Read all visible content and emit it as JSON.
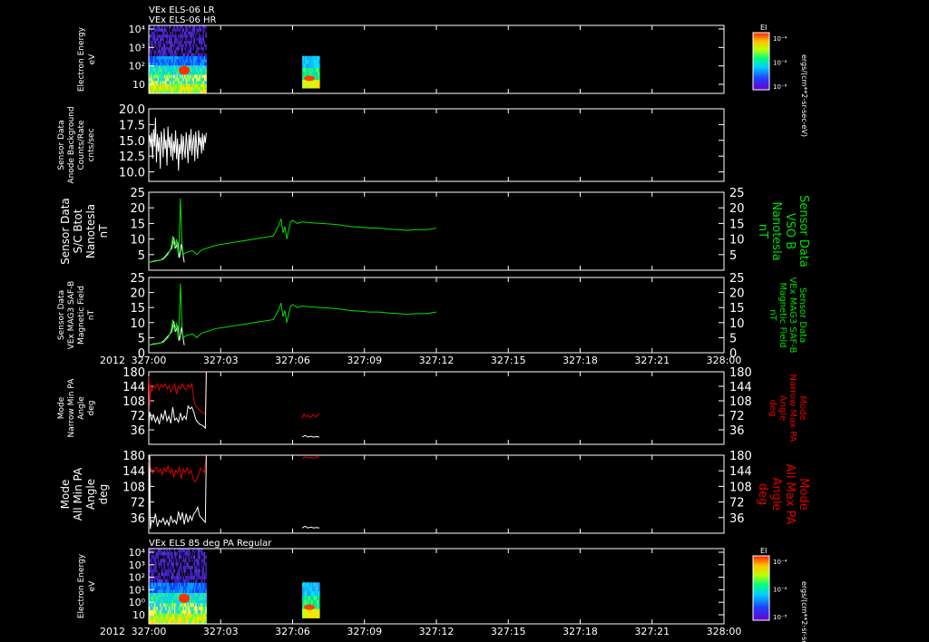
{
  "chart_data": {
    "type": "line",
    "x_axis": {
      "year_label": "2012",
      "range": [
        "327:00",
        "328:00"
      ],
      "ticks": [
        "327:00",
        "327:03",
        "327:06",
        "327:09",
        "327:12",
        "327:15",
        "327:18",
        "327:21",
        "328:00"
      ]
    },
    "panels": [
      {
        "id": "els06",
        "type": "heatmap",
        "titles": [
          "VEx ELS-06 LR",
          "VEx ELS-06 HR"
        ],
        "ylabel": [
          "Electron Energy",
          "eV"
        ],
        "y_ticks": [
          "10",
          "10²",
          "10³",
          "10⁴"
        ],
        "log_y": true,
        "colorbar": {
          "label": "EI",
          "unit": "ergs/(cm**2-sr-sec-eV)",
          "ticks": [
            "10⁻⁴",
            "10⁻⁶",
            "10⁻⁸"
          ]
        },
        "segments": [
          {
            "x": [
              327.0,
              327.06
            ],
            "energy_range_eV": [
              2,
              20000
            ]
          },
          {
            "x": [
              327.16,
              327.18
            ],
            "energy_range_eV": [
              3,
              300
            ]
          }
        ]
      },
      {
        "id": "background",
        "type": "line",
        "ylabel": [
          "Sensor Data",
          "Anode Background",
          "Counts/Rate",
          "cnts/sec"
        ],
        "ylim": [
          8.5,
          20.0
        ],
        "y_ticks": [
          "10.0",
          "12.5",
          "15.0",
          "17.5",
          "20.0"
        ],
        "series": [
          {
            "color": "#ffffff",
            "x": [
              0.0,
              0.1,
              0.2,
              0.3,
              0.4,
              0.5,
              0.6,
              0.7,
              0.8,
              0.9,
              1.0,
              1.1,
              1.2,
              1.3,
              1.4,
              1.5,
              1.6,
              1.7,
              1.8,
              1.9,
              2.0,
              2.1,
              2.2,
              2.3,
              2.4,
              2.5,
              2.6,
              2.7,
              2.8,
              2.9,
              3.0,
              3.1,
              3.2,
              3.3,
              3.4,
              3.5,
              3.6,
              3.7,
              3.8,
              3.9,
              4.0,
              4.1,
              4.2,
              4.3,
              4.4,
              4.5,
              4.6,
              4.7,
              4.8,
              4.9,
              5.0,
              5.1,
              5.2,
              5.3,
              5.4,
              5.5,
              5.6,
              5.7,
              5.8,
              5.9,
              6.0
            ],
            "y": [
              14.5,
              15.8,
              13.9,
              16.2,
              12.1,
              16.8,
              14.0,
              18.6,
              11.5,
              16.0,
              13.2,
              15.5,
              10.5,
              16.4,
              14.8,
              12.3,
              16.9,
              13.6,
              15.1,
              11.0,
              17.2,
              13.8,
              15.6,
              12.4,
              16.1,
              11.8,
              14.9,
              13.0,
              16.6,
              12.0,
              15.3,
              10.2,
              14.4,
              12.8,
              16.0,
              11.9,
              15.7,
              13.5,
              12.2,
              16.3,
              14.1,
              11.4,
              15.9,
              13.3,
              16.8,
              12.6,
              14.7,
              15.9,
              11.7,
              16.4,
              13.9,
              12.1,
              16.6,
              14.2,
              15.5,
              12.9,
              16.1,
              13.4,
              15.8,
              14.6,
              16.2
            ]
          }
        ]
      },
      {
        "id": "bmag",
        "type": "line",
        "ylabel": [
          "Sensor Data",
          "S/C Btot",
          "Nanotesla",
          "nT"
        ],
        "right_label": [
          "Sensor Data",
          "VSO B",
          "Nanotesla",
          "nT"
        ],
        "ylim": [
          0,
          25
        ],
        "y_ticks": [
          "5",
          "10",
          "15",
          "20",
          "25"
        ],
        "series": [
          {
            "color": "#ffffff",
            "x": [
              0.0,
              0.4,
              0.8,
              1.2,
              1.6,
              2.0,
              2.4,
              2.6,
              2.8,
              3.0,
              3.2,
              3.4,
              3.6,
              3.7
            ],
            "y": [
              2.5,
              2.8,
              3.0,
              3.2,
              4.0,
              5.5,
              7.0,
              10.5,
              7.0,
              9.0,
              4.0,
              8.5,
              4.5,
              2.5
            ]
          },
          {
            "color": "#00e000",
            "x": [
              0.0,
              0.5,
              1.0,
              1.5,
              2.0,
              2.3,
              2.5,
              2.7,
              2.9,
              3.1,
              3.3,
              3.45,
              3.6,
              3.8,
              4.2,
              4.6,
              5.0,
              5.5,
              6.0,
              7.0,
              8.0,
              9.0,
              10.0,
              11.0,
              12.0,
              13.0,
              13.5,
              13.8,
              14.0,
              14.2,
              14.4,
              14.6,
              14.8,
              15.0,
              15.5,
              16.0,
              17.0,
              18.0,
              19.0,
              20.0,
              21.0,
              22.0,
              23.0,
              24.0,
              25.0,
              26.0,
              27.0,
              28.0,
              29.0,
              30.0
            ],
            "y": [
              2.5,
              3.0,
              3.2,
              3.4,
              5.0,
              7.0,
              11.0,
              7.0,
              10.0,
              4.0,
              23.0,
              9.0,
              5.0,
              5.5,
              6.0,
              6.2,
              5.0,
              6.5,
              7.0,
              8.0,
              8.5,
              9.0,
              9.5,
              10.0,
              10.5,
              11.0,
              14.0,
              16.5,
              12.0,
              14.0,
              10.0,
              13.0,
              15.5,
              16.0,
              15.0,
              15.5,
              15.2,
              15.0,
              14.8,
              14.5,
              14.0,
              13.8,
              13.5,
              13.5,
              13.2,
              13.0,
              12.8,
              13.0,
              13.0,
              13.5
            ]
          }
        ]
      },
      {
        "id": "mag3",
        "type": "line",
        "ylabel": [
          "Sensor Data",
          "VEx MAG3 SAF-B",
          "Magnetic Field",
          "nT"
        ],
        "right_label": [
          "Sensor Data",
          "VEx MAG3 SAF-B",
          "Magnetic Field",
          "nT"
        ],
        "ylim": [
          0,
          25
        ],
        "y_ticks": [
          "0",
          "5",
          "10",
          "15",
          "20",
          "25"
        ],
        "series": [
          {
            "color": "#ffffff",
            "x": [
              0.0,
              0.4,
              0.8,
              1.2,
              1.6,
              2.0,
              2.4,
              2.6,
              2.8,
              3.0,
              3.2,
              3.4,
              3.6,
              3.7
            ],
            "y": [
              2.5,
              2.8,
              3.0,
              3.2,
              4.0,
              5.5,
              7.0,
              10.5,
              7.0,
              9.0,
              4.0,
              8.5,
              4.5,
              2.5
            ]
          },
          {
            "color": "#00e000",
            "x": [
              0.0,
              0.5,
              1.0,
              1.5,
              2.0,
              2.3,
              2.5,
              2.7,
              2.9,
              3.1,
              3.3,
              3.45,
              3.6,
              3.8,
              4.2,
              4.6,
              5.0,
              5.5,
              6.0,
              7.0,
              8.0,
              9.0,
              10.0,
              11.0,
              12.0,
              13.0,
              13.5,
              13.8,
              14.0,
              14.2,
              14.4,
              14.6,
              14.8,
              15.0,
              15.5,
              16.0,
              17.0,
              18.0,
              19.0,
              20.0,
              21.0,
              22.0,
              23.0,
              24.0,
              25.0,
              26.0,
              27.0,
              28.0,
              29.0,
              30.0
            ],
            "y": [
              2.5,
              3.0,
              3.2,
              3.4,
              5.0,
              7.0,
              11.0,
              7.0,
              10.0,
              4.0,
              23.0,
              9.0,
              5.0,
              5.5,
              6.0,
              6.2,
              5.0,
              6.5,
              7.0,
              8.0,
              8.5,
              9.0,
              9.5,
              10.0,
              10.5,
              11.0,
              14.0,
              16.5,
              12.0,
              14.0,
              10.0,
              13.0,
              15.5,
              16.0,
              15.0,
              15.5,
              15.2,
              15.0,
              14.8,
              14.5,
              14.0,
              13.8,
              13.5,
              13.5,
              13.2,
              13.0,
              12.8,
              13.0,
              13.0,
              13.5
            ]
          }
        ]
      },
      {
        "id": "pa_narrow",
        "type": "line",
        "ylabel": [
          "Mode",
          "Narrow Min PA",
          "Angle",
          "deg"
        ],
        "right_label": [
          "Mode",
          "Narrow Max PA",
          "Angle",
          "deg"
        ],
        "ylim": [
          0,
          180
        ],
        "y_ticks": [
          "36",
          "72",
          "108",
          "144",
          "180"
        ],
        "series": [
          {
            "color": "#e00000",
            "x": [
              0.0,
              0.1,
              0.2,
              0.3,
              0.5,
              0.7,
              0.9,
              1.1,
              1.3,
              1.5,
              1.7,
              1.9,
              2.1,
              2.3,
              2.5,
              2.7,
              2.9,
              3.1,
              3.3,
              3.5,
              3.7,
              3.9,
              4.1,
              4.3,
              4.5,
              4.7,
              4.9,
              5.1,
              5.3,
              5.5,
              5.7,
              5.9,
              6.0
            ],
            "y": [
              180,
              95,
              150,
              130,
              145,
              140,
              150,
              135,
              148,
              142,
              150,
              138,
              145,
              130,
              140,
              150,
              125,
              145,
              138,
              150,
              140,
              135,
              148,
              140,
              150,
              110,
              95,
              90,
              85,
              80,
              78,
              75,
              180
            ],
            "x2": [
              16.0,
              16.2,
              16.4,
              16.6,
              16.8,
              17.0,
              17.2,
              17.4,
              17.6,
              17.8
            ],
            "y2": [
              65,
              75,
              68,
              72,
              66,
              70,
              74,
              68,
              72,
              76
            ]
          },
          {
            "color": "#ffffff",
            "x": [
              0.0,
              0.1,
              0.3,
              0.5,
              0.7,
              0.9,
              1.1,
              1.3,
              1.5,
              1.7,
              1.9,
              2.1,
              2.3,
              2.5,
              2.7,
              2.9,
              3.1,
              3.3,
              3.5,
              3.7,
              3.9,
              4.1,
              4.3,
              4.5,
              4.7,
              4.9,
              5.1,
              5.3,
              5.5,
              5.7,
              5.9,
              6.0
            ],
            "y": [
              40,
              80,
              60,
              72,
              55,
              68,
              50,
              75,
              62,
              85,
              58,
              70,
              52,
              92,
              60,
              65,
              55,
              78,
              60,
              70,
              62,
              95,
              88,
              92,
              80,
              62,
              55,
              50,
              48,
              45,
              40,
              180
            ],
            "x2": [
              16.0,
              16.3,
              16.6,
              16.9,
              17.2,
              17.5,
              17.8
            ],
            "y2": [
              18,
              22,
              18,
              20,
              18,
              19,
              18
            ]
          }
        ]
      },
      {
        "id": "pa_all",
        "type": "line",
        "ylabel": [
          "Mode",
          "All Min PA",
          "Angle",
          "deg"
        ],
        "right_label": [
          "Mode",
          "All Max PA",
          "Angle",
          "deg"
        ],
        "ylim": [
          0,
          180
        ],
        "y_ticks": [
          "36",
          "72",
          "108",
          "144",
          "180"
        ],
        "series": [
          {
            "color": "#e00000",
            "x": [
              0.0,
              0.1,
              0.2,
              0.4,
              0.6,
              0.8,
              1.0,
              1.2,
              1.4,
              1.6,
              1.8,
              2.0,
              2.2,
              2.4,
              2.6,
              2.8,
              3.0,
              3.2,
              3.4,
              3.6,
              3.8,
              4.0,
              4.2,
              4.4,
              4.6,
              4.8,
              5.0,
              5.2,
              5.4,
              5.6,
              5.8,
              6.0
            ],
            "y": [
              180,
              140,
              150,
              138,
              145,
              152,
              140,
              148,
              135,
              150,
              142,
              155,
              138,
              148,
              130,
              145,
              140,
              152,
              125,
              148,
              140,
              150,
              138,
              145,
              130,
              118,
              125,
              135,
              150,
              145,
              140,
              180
            ],
            "x2": [
              16.0,
              16.3,
              16.6,
              16.9,
              17.2,
              17.5,
              17.8
            ],
            "y2": [
              172,
              176,
              174,
              175,
              173,
              176,
              175
            ]
          },
          {
            "color": "#ffffff",
            "x": [
              0.0,
              0.1,
              0.15,
              0.3,
              0.5,
              0.7,
              0.9,
              1.1,
              1.3,
              1.5,
              1.7,
              1.9,
              2.1,
              2.3,
              2.5,
              2.7,
              2.9,
              3.1,
              3.3,
              3.5,
              3.7,
              3.9,
              4.1,
              4.3,
              4.5,
              4.7,
              4.9,
              5.1,
              5.3,
              5.5,
              5.7,
              5.9,
              6.0
            ],
            "y": [
              20,
              180,
              10,
              30,
              25,
              45,
              15,
              30,
              25,
              35,
              20,
              30,
              18,
              40,
              25,
              30,
              22,
              50,
              30,
              48,
              20,
              45,
              25,
              40,
              30,
              45,
              50,
              60,
              40,
              35,
              30,
              25,
              180
            ],
            "x2": [
              16.0,
              16.3,
              16.6,
              16.9,
              17.2,
              17.5,
              17.8
            ],
            "y2": [
              12,
              16,
              12,
              14,
              12,
              13,
              12
            ]
          }
        ]
      },
      {
        "id": "els85",
        "type": "heatmap",
        "titles": [
          "VEx ELS 85 deg PA Regular"
        ],
        "ylabel": [
          "Electron Energy",
          "eV"
        ],
        "y_ticks": [
          "10",
          "10⁰",
          "10¹",
          "10²",
          "10³",
          "10⁴"
        ],
        "log_y": true,
        "colorbar": {
          "label": "EI",
          "unit": "ergs/(cm**2-sr-sec-eV)",
          "ticks": [
            "10⁻⁴",
            "10⁻⁶",
            "10⁻⁸"
          ]
        },
        "segments": [
          {
            "x": [
              327.0,
              327.06
            ],
            "energy_range_eV": [
              0.3,
              20000
            ]
          },
          {
            "x": [
              327.16,
              327.18
            ],
            "energy_range_eV": [
              2,
              300
            ]
          }
        ]
      }
    ]
  }
}
